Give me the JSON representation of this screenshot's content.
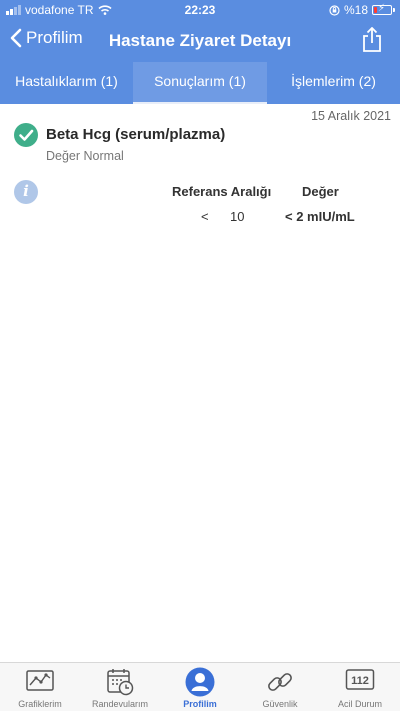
{
  "status_bar": {
    "carrier": "vodafone TR",
    "time": "22:23",
    "battery": "%18"
  },
  "nav": {
    "back_label": "Profilim",
    "title": "Hastane Ziyaret Detayı"
  },
  "tabs": [
    {
      "label": "Hastalıklarım (1)",
      "active": false
    },
    {
      "label": "Sonuçlarım (1)",
      "active": true
    },
    {
      "label": "İşlemlerim (2)",
      "active": false
    }
  ],
  "result": {
    "date": "15 Aralık 2021",
    "test_name": "Beta Hcg (serum/plazma)",
    "status": "Değer Normal",
    "ref_header": "Referans Aralığı",
    "value_header": "Değer",
    "ref_operator": "<",
    "ref_value": "10",
    "value": "< 2 mIU/mL"
  },
  "bottom_nav": [
    {
      "label": "Grafiklerim",
      "icon": "chart-icon"
    },
    {
      "label": "Randevularım",
      "icon": "calendar-icon"
    },
    {
      "label": "Profilim",
      "icon": "profile-icon",
      "active": true
    },
    {
      "label": "Güvenlik",
      "icon": "link-icon"
    },
    {
      "label": "Acil Durum",
      "icon": "emergency-112-icon",
      "badge": "112"
    }
  ],
  "colors": {
    "header": "#5a8de0",
    "active_nav": "#3a6fd6",
    "success": "#3fae8a"
  }
}
